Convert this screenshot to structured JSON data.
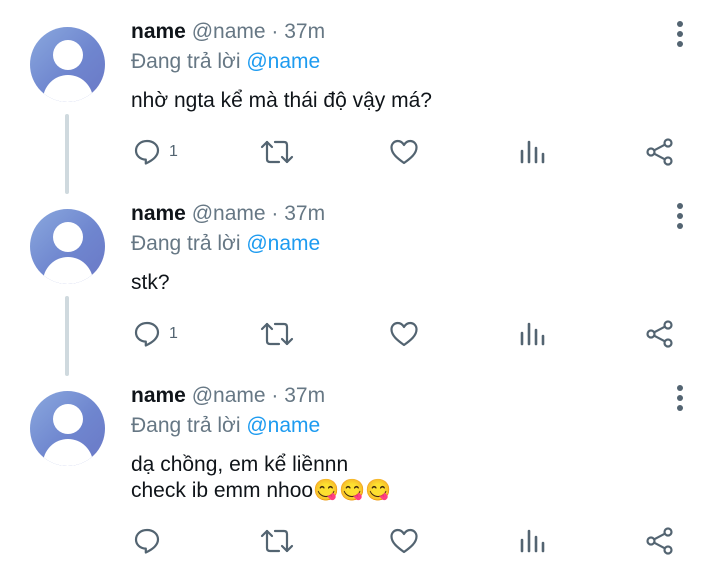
{
  "tweets": [
    {
      "name": "name",
      "handle": "@name",
      "dot": "·",
      "time": "37m",
      "reply_prefix": "Đang trả lời",
      "reply_to": "@name",
      "text": "nhờ ngta kể mà thái độ vậy má?",
      "reply_count": "1"
    },
    {
      "name": "name",
      "handle": "@name",
      "dot": "·",
      "time": "37m",
      "reply_prefix": "Đang trả lời",
      "reply_to": "@name",
      "text": "stk?",
      "reply_count": "1"
    },
    {
      "name": "name",
      "handle": "@name",
      "dot": "·",
      "time": "37m",
      "reply_prefix": "Đang trả lời",
      "reply_to": "@name",
      "text": "dạ chồng, em kể liềnnn\ncheck ib emm nhoo😋😋😋",
      "reply_count": ""
    }
  ],
  "icons": {
    "reply": "reply-icon",
    "retweet": "retweet-icon",
    "like": "heart-icon",
    "stats": "stats-icon",
    "share": "share-icon",
    "more": "more-vertical-icon",
    "avatar": "default-avatar-icon"
  },
  "colors": {
    "mention": "#1d9bf0",
    "secondary_text": "#667784",
    "icon": "#536471",
    "thread_line": "#cfd9de"
  }
}
